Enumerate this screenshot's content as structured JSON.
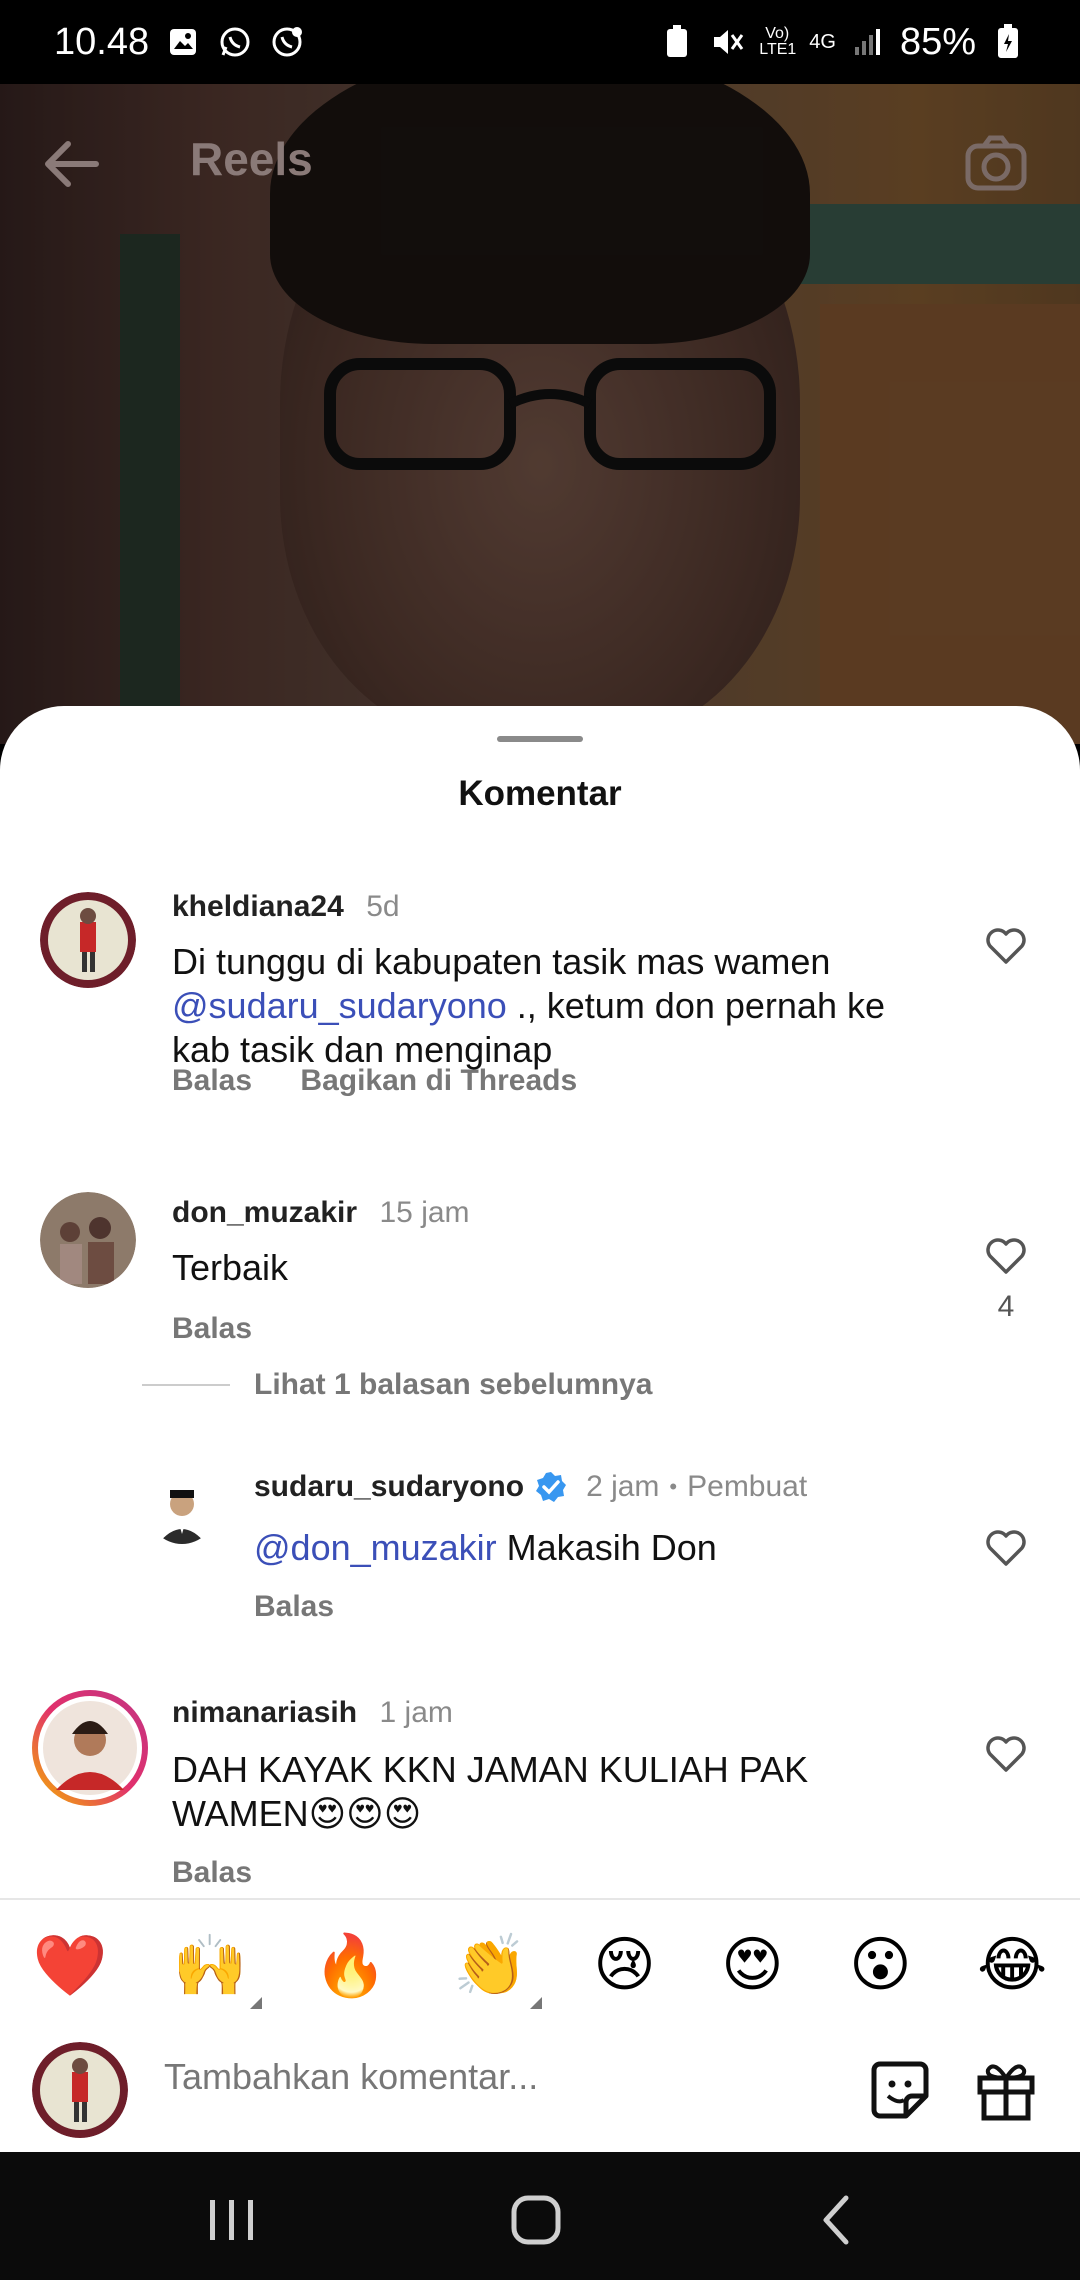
{
  "status_bar": {
    "time": "10.48",
    "battery": "85%",
    "network_labels": [
      "Vo) LTE1",
      "4G"
    ]
  },
  "header": {
    "title": "Reels"
  },
  "sheet": {
    "title": "Komentar"
  },
  "comments": [
    {
      "username": "kheldiana24",
      "time": "5d",
      "text_before": "Di tunggu di kabupaten tasik mas wamen",
      "mention": "@sudaru_sudaryono",
      "text_after": " ., ketum don pernah ke kab tasik dan menginap",
      "reply_label": "Balas",
      "share_label": "Bagikan di Threads"
    },
    {
      "username": "don_muzakir",
      "time": "15 jam",
      "text": "Terbaik",
      "reply_label": "Balas",
      "like_count": "4"
    }
  ],
  "view_replies": "Lihat 1 balasan sebelumnya",
  "reply": {
    "username": "sudaru_sudaryono",
    "time": "2 jam",
    "separator": "•",
    "creator_label": "Pembuat",
    "mention": "@don_muzakir",
    "text": " Makasih Don",
    "reply_label": "Balas"
  },
  "comment3": {
    "username": "nimanariasih",
    "time": "1 jam",
    "text": "DAH KAYAK KKN JAMAN KULIAH PAK WAMEN😍😍😍",
    "reply_label": "Balas"
  },
  "reactions": [
    "❤️",
    "🙌",
    "🔥",
    "👏",
    "😢",
    "😍",
    "😮",
    "😂"
  ],
  "input": {
    "placeholder": "Tambahkan komentar..."
  },
  "colors": {
    "mention": "#3b4fb8",
    "verified": "#3897f0",
    "story_ring_start": "#c13584",
    "story_ring_end": "#f4b400"
  }
}
